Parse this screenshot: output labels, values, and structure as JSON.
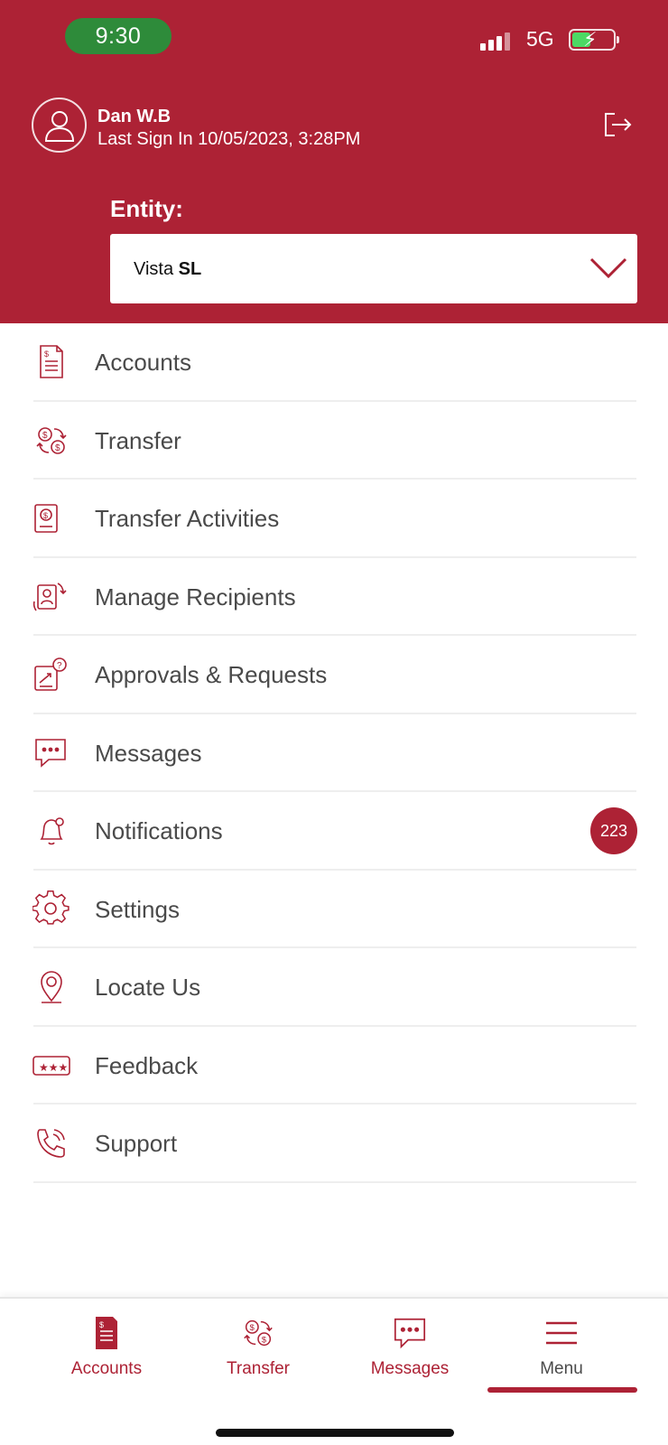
{
  "status_bar": {
    "time": "9:30",
    "network": "5G"
  },
  "user": {
    "name": "Dan W.B",
    "last_sign_in": "Last Sign In 10/05/2023, 3:28PM"
  },
  "entity": {
    "label": "Entity:",
    "value_prefix": "Vista",
    "value_bold": "SL"
  },
  "menu": {
    "items": [
      {
        "label": "Accounts",
        "icon": "accounts-icon"
      },
      {
        "label": "Transfer",
        "icon": "transfer-icon"
      },
      {
        "label": "Transfer Activities",
        "icon": "transfer-activities-icon"
      },
      {
        "label": "Manage Recipients",
        "icon": "manage-recipients-icon"
      },
      {
        "label": "Approvals & Requests",
        "icon": "approvals-icon"
      },
      {
        "label": "Messages",
        "icon": "messages-icon"
      },
      {
        "label": "Notifications",
        "icon": "bell-icon",
        "badge": "223"
      },
      {
        "label": "Settings",
        "icon": "gear-icon"
      },
      {
        "label": "Locate Us",
        "icon": "location-pin-icon"
      },
      {
        "label": "Feedback",
        "icon": "feedback-icon"
      },
      {
        "label": "Support",
        "icon": "phone-icon"
      }
    ]
  },
  "tabbar": {
    "tabs": [
      {
        "label": "Accounts",
        "icon": "accounts-icon"
      },
      {
        "label": "Transfer",
        "icon": "transfer-icon"
      },
      {
        "label": "Messages",
        "icon": "messages-icon"
      },
      {
        "label": "Menu",
        "icon": "menu-icon",
        "active": true
      }
    ]
  },
  "colors": {
    "brand": "#ad2235",
    "text": "#4a4a4a",
    "status_green": "#2e8b3a"
  }
}
